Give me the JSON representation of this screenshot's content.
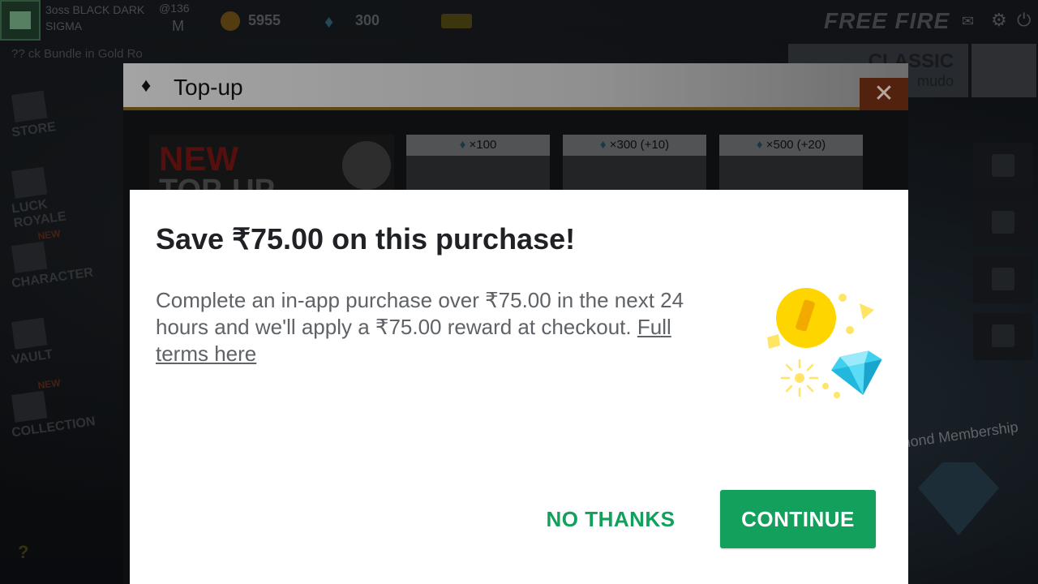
{
  "game": {
    "player_name": "3oss BLACK DARK SIGMA",
    "player_level": "@136",
    "coins": "5955",
    "diamonds": "300",
    "logo": "FREE FIRE",
    "ticker": "?? ck Bundle in Gold Ro",
    "nav": [
      {
        "label": "STORE",
        "icon": "store-icon"
      },
      {
        "label": "LUCK ROYALE",
        "icon": "luck-royale-icon"
      },
      {
        "label": "CHARACTER",
        "icon": "character-icon",
        "badge": "NEW"
      },
      {
        "label": "VAULT",
        "icon": "vault-icon"
      },
      {
        "label": "COLLECTION",
        "icon": "collection-icon",
        "badge": "NEW"
      }
    ],
    "mode_title": "CLASSIC",
    "mode_subtitle": "mudo",
    "membership_label": "nond Membership",
    "colors": {
      "accent_gold": "#7a5d18",
      "close_red": "#6b2c14"
    }
  },
  "topup": {
    "title": "Top-up",
    "promo_line1": "NEW",
    "promo_line2": "TOP-UP",
    "packages": [
      {
        "label": "×100"
      },
      {
        "label": "×300 (+10)"
      },
      {
        "label": "×500 (+20)"
      }
    ],
    "close_glyph": "✕"
  },
  "dialog": {
    "title": "Save ₹75.00 on this purchase!",
    "body_text": "Complete an in-app purchase over ₹75.00 in the next 24 hours and we'll apply a ₹75.00 reward at checkout. ",
    "link_text": "Full terms here",
    "no_thanks_label": "NO THANKS",
    "continue_label": "CONTINUE",
    "illustration": "coin-and-diamond-icon",
    "colors": {
      "primary": "#12a05c",
      "title": "#202124",
      "body": "#5f6368",
      "coin": "#ffd500",
      "gem": "#3fd0f0"
    }
  }
}
